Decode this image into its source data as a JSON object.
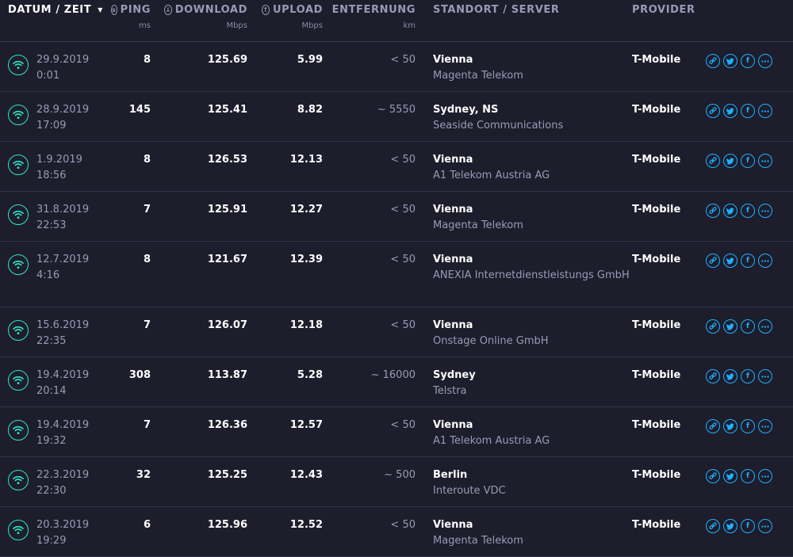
{
  "header": {
    "date": "DATUM / ZEIT",
    "ping": "PING",
    "ping_unit": "ms",
    "download": "DOWNLOAD",
    "download_unit": "Mbps",
    "upload": "UPLOAD",
    "upload_unit": "Mbps",
    "distance": "ENTFERNUNG",
    "distance_unit": "km",
    "server": "STANDORT / SERVER",
    "provider": "PROVIDER"
  },
  "rows": [
    {
      "date": "29.9.2019",
      "time": "0:01",
      "ping": "8",
      "download": "125.69",
      "upload": "5.99",
      "distance": "< 50",
      "city": "Vienna",
      "isp": "Magenta Telekom",
      "provider": "T-Mobile"
    },
    {
      "date": "28.9.2019",
      "time": "17:09",
      "ping": "145",
      "download": "125.41",
      "upload": "8.82",
      "distance": "~ 5550",
      "city": "Sydney, NS",
      "isp": "Seaside Communications",
      "provider": "T-Mobile"
    },
    {
      "date": "1.9.2019",
      "time": "18:56",
      "ping": "8",
      "download": "126.53",
      "upload": "12.13",
      "distance": "< 50",
      "city": "Vienna",
      "isp": "A1 Telekom Austria AG",
      "provider": "T-Mobile"
    },
    {
      "date": "31.8.2019",
      "time": "22:53",
      "ping": "7",
      "download": "125.91",
      "upload": "12.27",
      "distance": "< 50",
      "city": "Vienna",
      "isp": "Magenta Telekom",
      "provider": "T-Mobile"
    },
    {
      "date": "12.7.2019",
      "time": "4:16",
      "ping": "8",
      "download": "121.67",
      "upload": "12.39",
      "distance": "< 50",
      "city": "Vienna",
      "isp": "ANEXIA Internetdienstleistungs GmbH",
      "provider": "T-Mobile"
    },
    {
      "date": "15.6.2019",
      "time": "22:35",
      "ping": "7",
      "download": "126.07",
      "upload": "12.18",
      "distance": "< 50",
      "city": "Vienna",
      "isp": "Onstage Online GmbH",
      "provider": "T-Mobile"
    },
    {
      "date": "19.4.2019",
      "time": "20:14",
      "ping": "308",
      "download": "113.87",
      "upload": "5.28",
      "distance": "~ 16000",
      "city": "Sydney",
      "isp": "Telstra",
      "provider": "T-Mobile"
    },
    {
      "date": "19.4.2019",
      "time": "19:32",
      "ping": "7",
      "download": "126.36",
      "upload": "12.57",
      "distance": "< 50",
      "city": "Vienna",
      "isp": "A1 Telekom Austria AG",
      "provider": "T-Mobile"
    },
    {
      "date": "22.3.2019",
      "time": "22:30",
      "ping": "32",
      "download": "125.25",
      "upload": "12.43",
      "distance": "~ 500",
      "city": "Berlin",
      "isp": "Interoute VDC",
      "provider": "T-Mobile"
    },
    {
      "date": "20.3.2019",
      "time": "19:29",
      "ping": "6",
      "download": "125.96",
      "upload": "12.52",
      "distance": "< 50",
      "city": "Vienna",
      "isp": "Magenta Telekom",
      "provider": "T-Mobile"
    }
  ],
  "icons": {
    "connection": "wifi-icon",
    "actions": [
      "link-icon",
      "twitter-icon",
      "facebook-icon",
      "more-icon"
    ]
  },
  "colors": {
    "background": "#1d1d2c",
    "wifi": "#2ee6c8",
    "action": "#1fb0ff",
    "muted": "#9a9ab6"
  }
}
